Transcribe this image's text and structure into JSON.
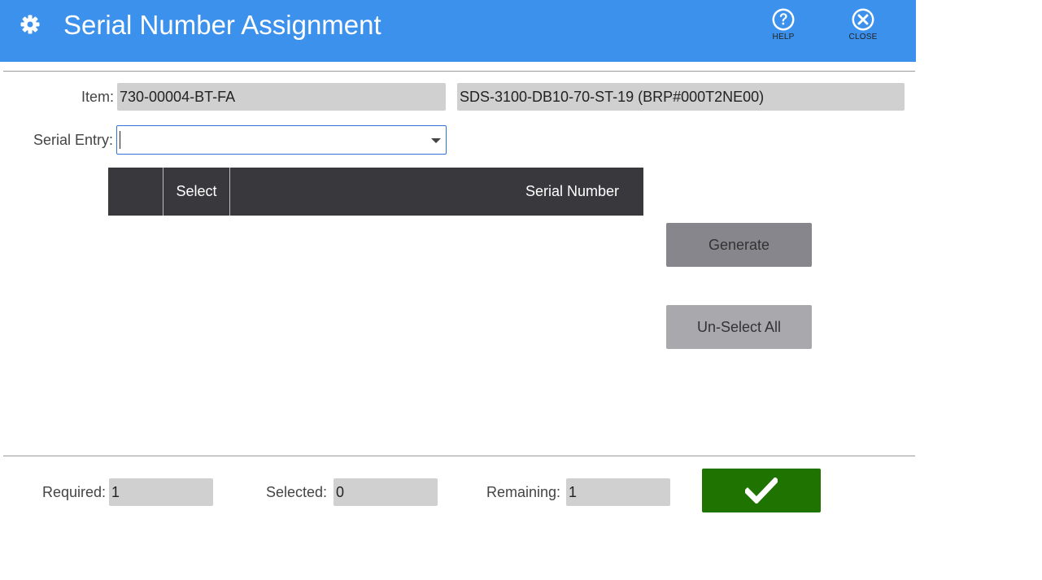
{
  "header": {
    "title": "Serial Number Assignment",
    "help_label": "HELP",
    "close_label": "CLOSE",
    "background_color": "#3b91ec"
  },
  "form": {
    "item_label": "Item:",
    "item_value": "730-00004-BT-FA",
    "item_description": "SDS-3100-DB10-70-ST-19 (BRP#000T2NE00)",
    "serial_entry_label": "Serial Entry:",
    "serial_entry_value": ""
  },
  "grid": {
    "columns": [
      "",
      "Select",
      "Serial Number"
    ],
    "rows": []
  },
  "actions": {
    "generate_label": "Generate",
    "unselect_all_label": "Un-Select All"
  },
  "footer": {
    "required_label": "Required:",
    "required_value": "1",
    "selected_label": "Selected:",
    "selected_value": "0",
    "remaining_label": "Remaining:",
    "remaining_value": "1",
    "confirm_icon": "checkmark-icon",
    "confirm_color": "#1f7300"
  }
}
